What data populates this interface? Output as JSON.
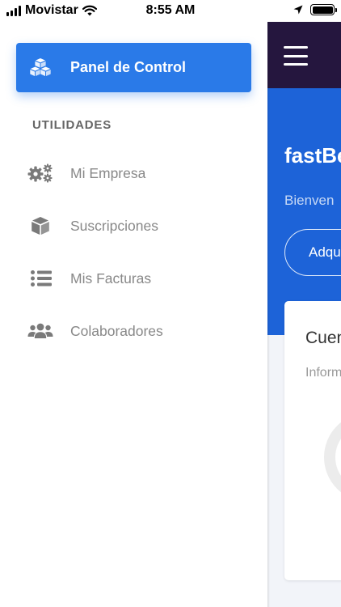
{
  "status_bar": {
    "carrier": "Movistar",
    "time": "8:55 AM"
  },
  "sidebar": {
    "active_item": {
      "label": "Panel de Control",
      "icon": "cubes-icon"
    },
    "section_title": "UTILIDADES",
    "items": [
      {
        "label": "Mi Empresa",
        "icon": "gears-icon"
      },
      {
        "label": "Suscripciones",
        "icon": "box-icon"
      },
      {
        "label": "Mis Facturas",
        "icon": "list-icon"
      },
      {
        "label": "Colaboradores",
        "icon": "users-icon"
      }
    ]
  },
  "main": {
    "hero": {
      "title": "fastBe",
      "subtitle": "Bienven",
      "button_label": "Adqu"
    },
    "card": {
      "title": "Cuen",
      "subtitle": "Inform"
    }
  },
  "colors": {
    "accent": "#2a7ae8",
    "navbar": "#25163e",
    "hero": "#1d63d8",
    "muted_text": "#888888"
  }
}
